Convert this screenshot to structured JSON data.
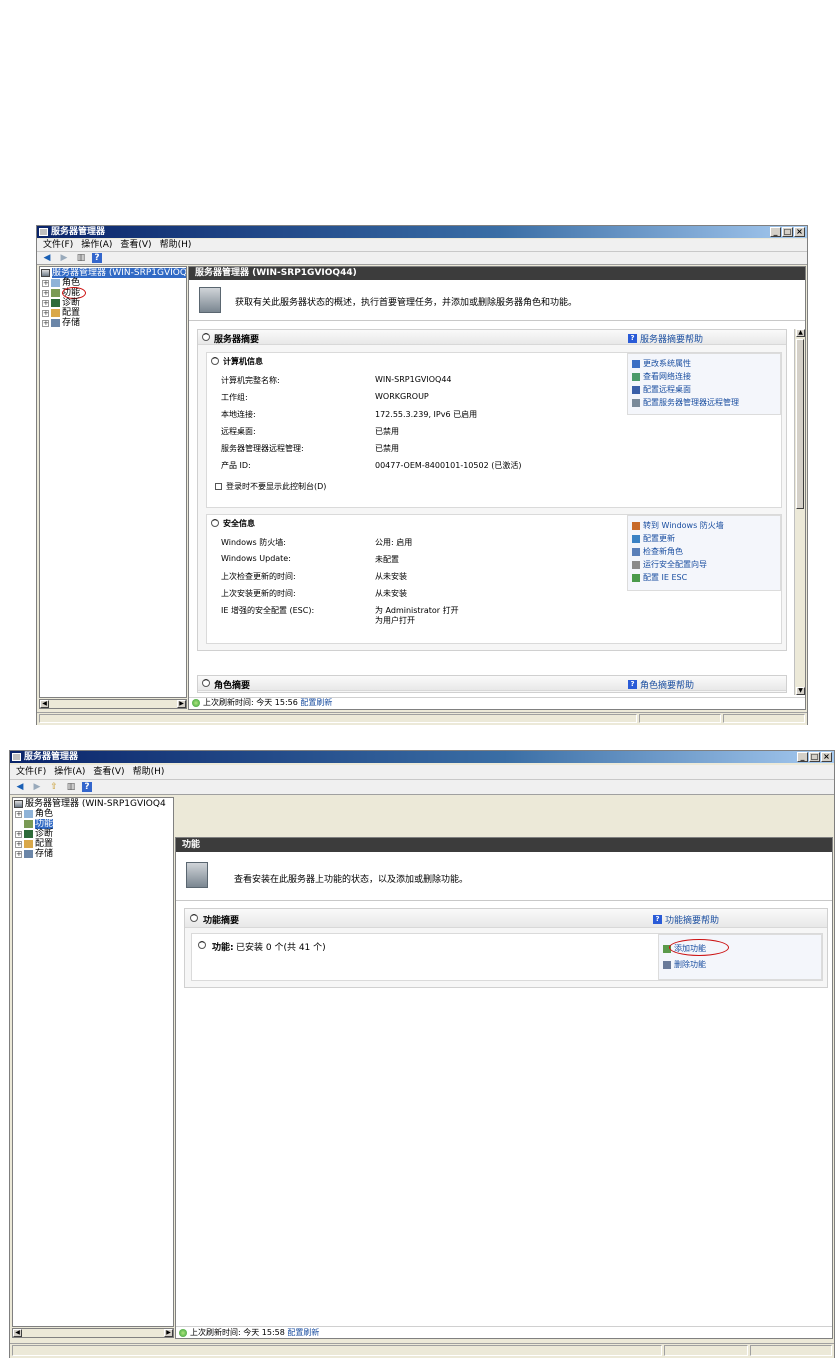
{
  "window1": {
    "title": "服务器管理器",
    "menu": [
      "文件(F)",
      "操作(A)",
      "查看(V)",
      "帮助(H)"
    ],
    "tree": {
      "root": "服务器管理器 (WIN-SRP1GVIOQ4",
      "items": [
        "角色",
        "功能",
        "诊断",
        "配置",
        "存储"
      ]
    },
    "content_title": "服务器管理器 (WIN-SRP1GVIOQ44)",
    "intro": "获取有关此服务器状态的概述，执行首要管理任务，并添加或删除服务器角色和功能。",
    "server_summary": {
      "title": "服务器摘要",
      "help": "服务器摘要帮助",
      "computer_info": {
        "title": "计算机信息",
        "rows": [
          {
            "label": "计算机完整名称:",
            "value": "WIN-SRP1GVIOQ44"
          },
          {
            "label": "工作组:",
            "value": "WORKGROUP"
          },
          {
            "label": "本地连接:",
            "value": "172.55.3.239, IPv6 已启用"
          },
          {
            "label": "远程桌面:",
            "value": "已禁用"
          },
          {
            "label": "服务器管理器远程管理:",
            "value": "已禁用"
          },
          {
            "label": "产品 ID:",
            "value": "00477-OEM-8400101-10502 (已激活)"
          }
        ],
        "checkbox": "登录时不要显示此控制台(D)",
        "tasks": [
          "更改系统属性",
          "查看网络连接",
          "配置远程桌面",
          "配置服务器管理器远程管理"
        ]
      },
      "security_info": {
        "title": "安全信息",
        "rows": [
          {
            "label": "Windows 防火墙:",
            "value": "公用: 启用"
          },
          {
            "label": "Windows Update:",
            "value": "未配置"
          },
          {
            "label": "上次检查更新的时间:",
            "value": "从未安装"
          },
          {
            "label": "上次安装更新的时间:",
            "value": "从未安装"
          },
          {
            "label": "IE 增强的安全配置 (ESC):",
            "value": "为 Administrator 打开",
            "value2": "为用户打开"
          }
        ],
        "tasks": [
          "转到 Windows 防火墙",
          "配置更新",
          "检查新角色",
          "运行安全配置向导",
          "配置 IE ESC"
        ]
      }
    },
    "roles_summary": {
      "title": "角色摘要",
      "help": "角色摘要帮助"
    },
    "refresh": {
      "text": "上次刷新时间: 今天 15:56",
      "link": "配置刷新"
    }
  },
  "window2": {
    "title": "服务器管理器",
    "menu": [
      "文件(F)",
      "操作(A)",
      "查看(V)",
      "帮助(H)"
    ],
    "tree": {
      "root": "服务器管理器 (WIN-SRP1GVIOQ4",
      "items": [
        "角色",
        "功能",
        "诊断",
        "配置",
        "存储"
      ]
    },
    "content_title": "功能",
    "intro": "查看安装在此服务器上功能的状态，以及添加或删除功能。",
    "features_summary": {
      "title": "功能摘要",
      "help": "功能摘要帮助",
      "features_line_label": "功能:",
      "features_line_value": "已安装 0 个(共 41 个)",
      "tasks": [
        "添加功能",
        "删除功能"
      ]
    },
    "refresh": {
      "text": "上次刷新时间: 今天 15:58",
      "link": "配置刷新"
    }
  }
}
